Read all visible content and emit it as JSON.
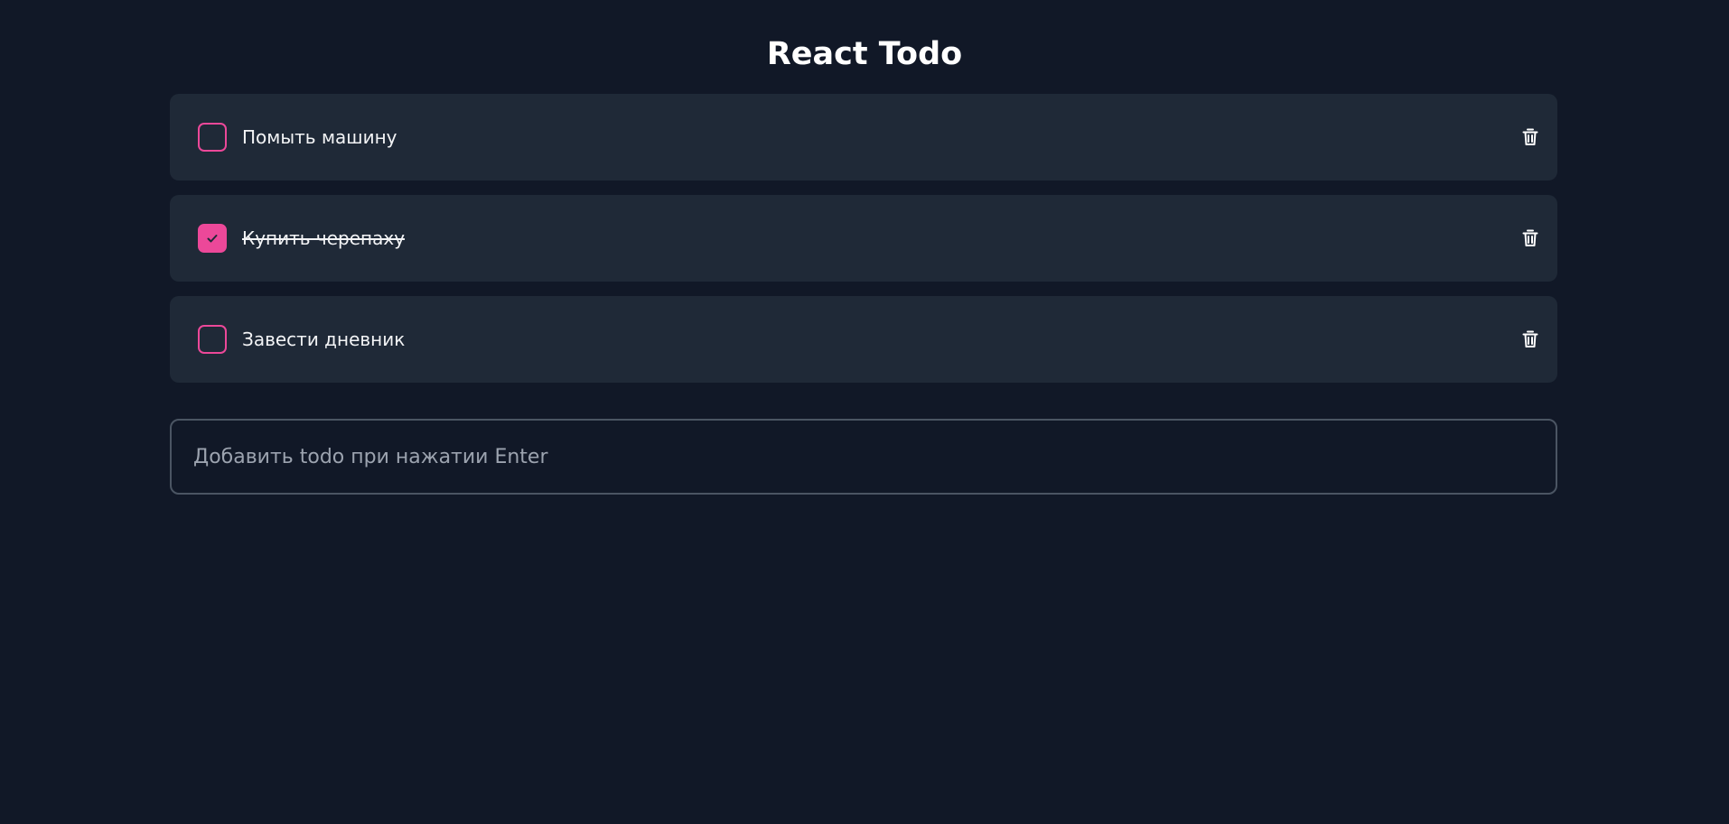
{
  "app": {
    "title": "React Todo"
  },
  "todos": [
    {
      "text": "Помыть машину",
      "completed": false
    },
    {
      "text": "Купить черепаху",
      "completed": true
    },
    {
      "text": "Завести дневник",
      "completed": false
    }
  ],
  "new_todo": {
    "value": "",
    "placeholder": "Добавить todo при нажатии Enter"
  },
  "icons": {
    "checkbox_check": "check-icon",
    "delete": "trash-icon"
  },
  "colors": {
    "background": "#111827",
    "card": "#1f2937",
    "accent": "#ec4899",
    "input_border": "#4b5563",
    "placeholder": "#9ca3af"
  }
}
